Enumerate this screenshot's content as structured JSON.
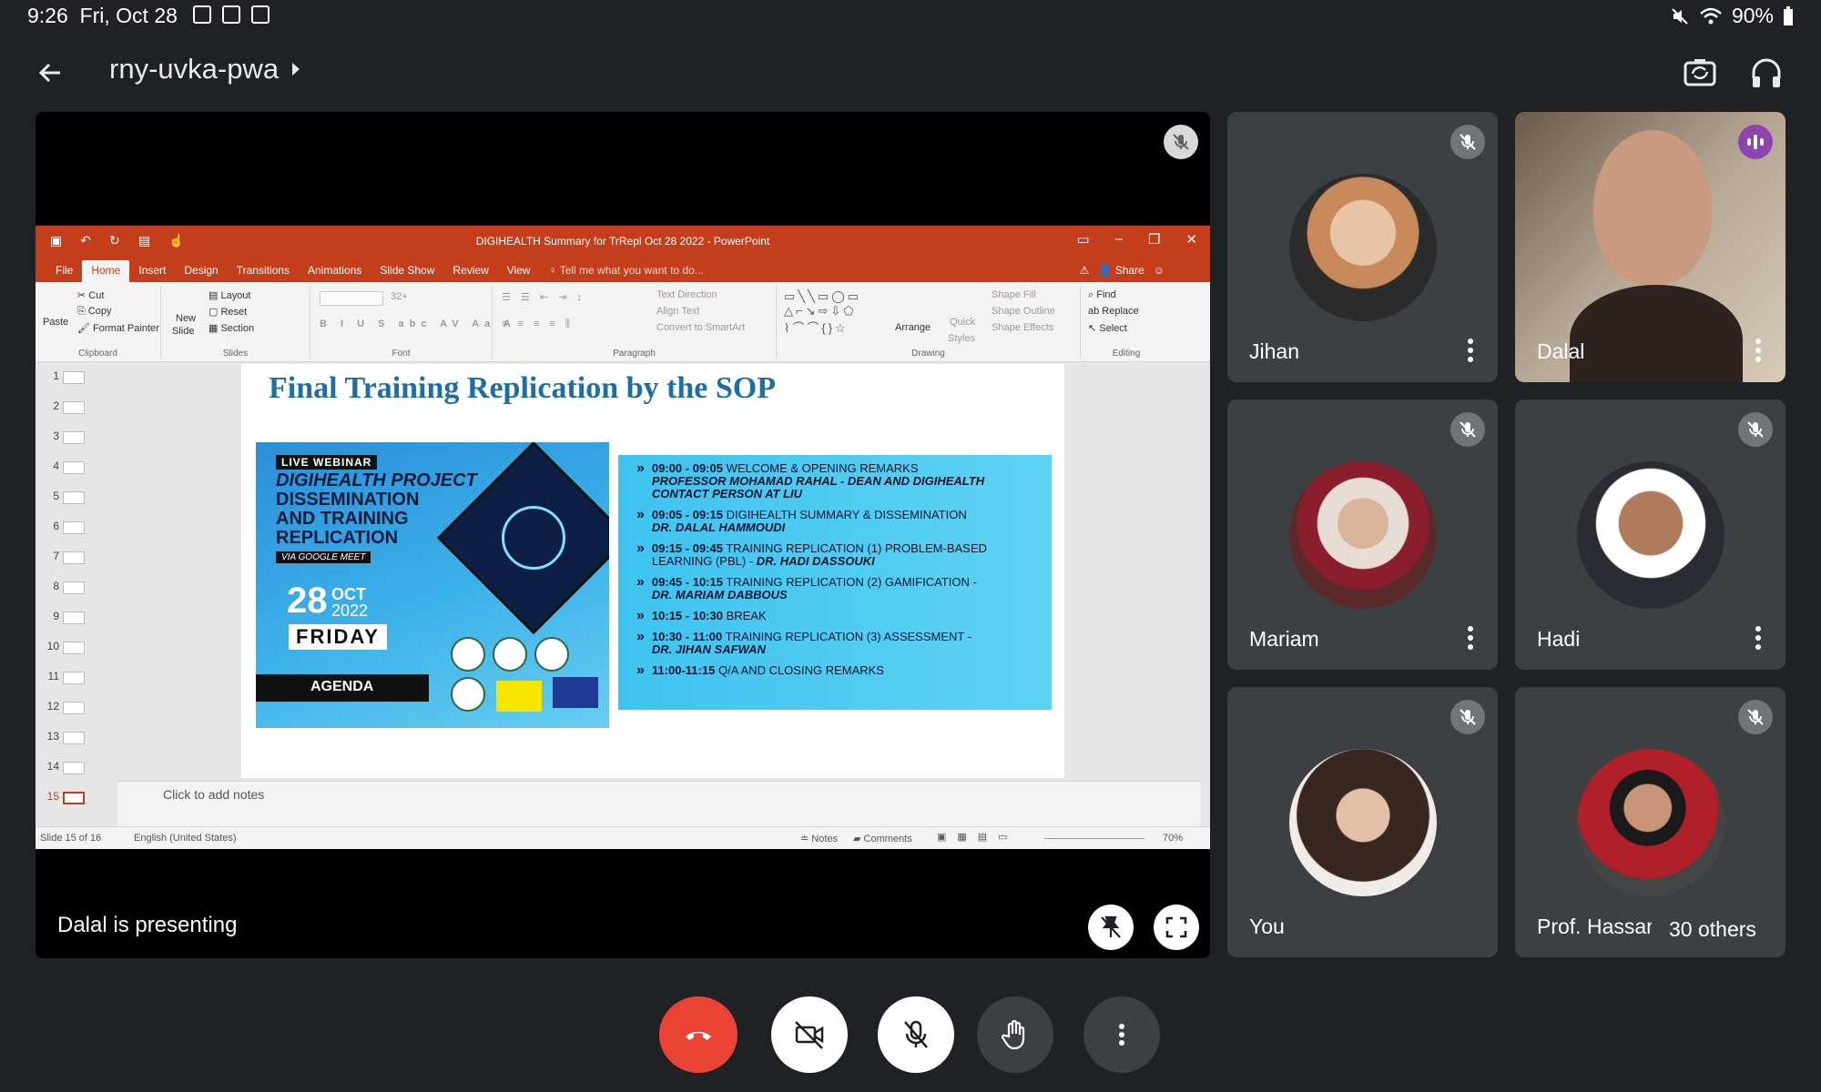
{
  "status": {
    "time": "9:26",
    "date": "Fri, Oct 28",
    "battery": "90%"
  },
  "header": {
    "meeting_code": "rny-uvka-pwa"
  },
  "presentation": {
    "presenter_label": "Dalal is presenting",
    "ppt": {
      "window_title": "DIGIHEALTH Summary for TrRepl Oct 28 2022 - PowerPoint",
      "tabs": [
        "File",
        "Home",
        "Insert",
        "Design",
        "Transitions",
        "Animations",
        "Slide Show",
        "Review",
        "View"
      ],
      "tell_me": "Tell me what you want to do...",
      "share": "Share",
      "ribbon": {
        "clipboard": {
          "paste": "Paste",
          "cut": "Cut",
          "copy": "Copy",
          "format_painter": "Format Painter",
          "label": "Clipboard"
        },
        "slides": {
          "new_slide": "New",
          "new_slide2": "Slide",
          "layout": "Layout",
          "reset": "Reset",
          "section": "Section",
          "label": "Slides"
        },
        "font": {
          "size": "32+",
          "label": "Font"
        },
        "paragraph": {
          "text_direction": "Text Direction",
          "align_text": "Align Text",
          "smartart": "Convert to SmartArt",
          "label": "Paragraph"
        },
        "drawing": {
          "arrange": "Arrange",
          "quick": "Quick",
          "styles": "Styles",
          "shape_fill": "Shape Fill",
          "shape_outline": "Shape Outline",
          "shape_effects": "Shape Effects",
          "label": "Drawing"
        },
        "editing": {
          "find": "Find",
          "replace": "Replace",
          "select": "Select",
          "label": "Editing"
        }
      },
      "thumbnails": [
        "1",
        "2",
        "3",
        "4",
        "5",
        "6",
        "7",
        "8",
        "9",
        "10",
        "11",
        "12",
        "13",
        "14",
        "15"
      ],
      "active_slide": "15",
      "slide": {
        "title": "Final Training Replication by the SOP",
        "poster": {
          "badge": "LIVE WEBINAR",
          "title_line1": "DIGIHEALTH PROJECT",
          "title_line2": "DISSEMINATION",
          "title_line3": "AND TRAINING",
          "title_line4": "REPLICATION",
          "via": "VIA GOOGLE MEET",
          "day_num": "28",
          "month": "OCT",
          "year": "2022",
          "weekday": "FRIDAY",
          "agenda": "AGENDA"
        },
        "agenda": [
          {
            "time": "09:00 - 09:05",
            "text": "WELCOME & OPENING REMARKS",
            "sub": "PROFESSOR MOHAMAD RAHAL - DEAN AND DIGIHEALTH CONTACT PERSON AT LIU"
          },
          {
            "time": "09:05 - 09:15",
            "text": "DIGIHEALTH SUMMARY & DISSEMINATION",
            "sub": "DR. DALAL HAMMOUDI"
          },
          {
            "time": "09:15 - 09:45",
            "text": "TRAINING REPLICATION (1) PROBLEM-BASED LEARNING (PBL) - ",
            "sub": "DR. HADI DASSOUKI"
          },
          {
            "time": "09:45 - 10:15",
            "text": "TRAINING REPLICATION (2) GAMIFICATION -",
            "sub": "DR. MARIAM DABBOUS"
          },
          {
            "time": "10:15 - 10:30",
            "text": "BREAK",
            "sub": ""
          },
          {
            "time": "10:30 - 11:00",
            "text": "TRAINING REPLICATION (3) ASSESSMENT -",
            "sub": "DR. JIHAN SAFWAN"
          },
          {
            "time": "11:00-11:15",
            "text": "Q/A AND CLOSING REMARKS",
            "sub": ""
          }
        ]
      },
      "notes_placeholder": "Click to add notes",
      "statusbar": {
        "slide_of": "Slide 15 of 16",
        "language": "English (United States)",
        "notes": "Notes",
        "comments": "Comments",
        "zoom": "70%"
      }
    }
  },
  "participants": [
    {
      "name": "Jihan",
      "muted": true
    },
    {
      "name": "Dalal",
      "speaking": true
    },
    {
      "name": "Mariam",
      "muted": true
    },
    {
      "name": "Hadi",
      "muted": true
    },
    {
      "name": "You",
      "muted": true
    },
    {
      "name": "Prof. Hassan",
      "muted": true
    }
  ],
  "others_badge": "30 others",
  "colors": {
    "background": "#202124",
    "tile": "#3c4043",
    "leave": "#ea4335",
    "powerpoint": "#c43e1c",
    "speaking": "#8e44ad"
  }
}
